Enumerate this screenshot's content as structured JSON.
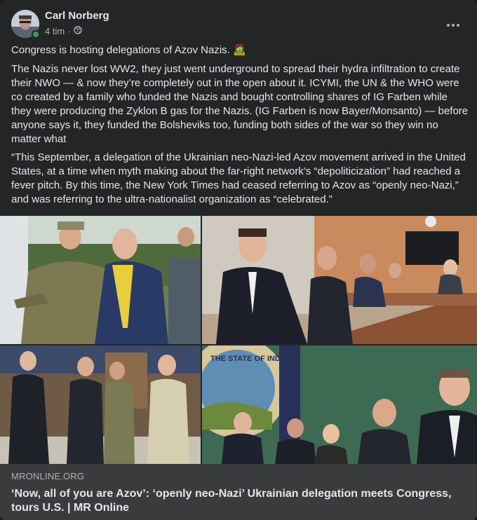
{
  "post": {
    "author": "Carl Norberg",
    "time": "4 tim",
    "dot": "·",
    "privacy_icon": "globe-icon",
    "line1": "Congress is hosting delegations of Azov Nazis. 🧟",
    "line2": "The Nazis never lost WW2, they just went underground to spread their hydra infiltration to create their NWO — & now they’re completely out in the open about it. ICYMI, the UN & the WHO were co created by a family who funded the Nazis and bought controlling shares of IG Farben while they were producing the Zyklon B gas for the Nazis. (IG Farben is now Bayer/Monsanto) — before anyone says it, they funded the Bolsheviks too, funding both sides of the war so they win no matter what",
    "line3": "“This September, a delegation of the Ukrainian neo-Nazi-led Azov movement arrived in the United States, at a time when myth making about the far-right network’s “depoliticization” had reached a fever pitch. By this time, the New York Times had ceased referring to Azov as “openly neo-Nazi,” and was referring to the ultra-nationalist organization as “celebrated.”"
  },
  "photos": {
    "seal_text": "THE STATE OF INDIANA"
  },
  "link_preview": {
    "domain": "MRONLINE.ORG",
    "title": "‘Now, all of you are Azov’: ‘openly neo-Nazi’ Ukrainian delegation meets Congress, tours U.S. | MR Online"
  },
  "colors": {
    "card_bg": "#242526",
    "link_bg": "#3a3b3c",
    "text_primary": "#e4e6eb",
    "text_secondary": "#b0b3b8",
    "online": "#31a24c"
  }
}
